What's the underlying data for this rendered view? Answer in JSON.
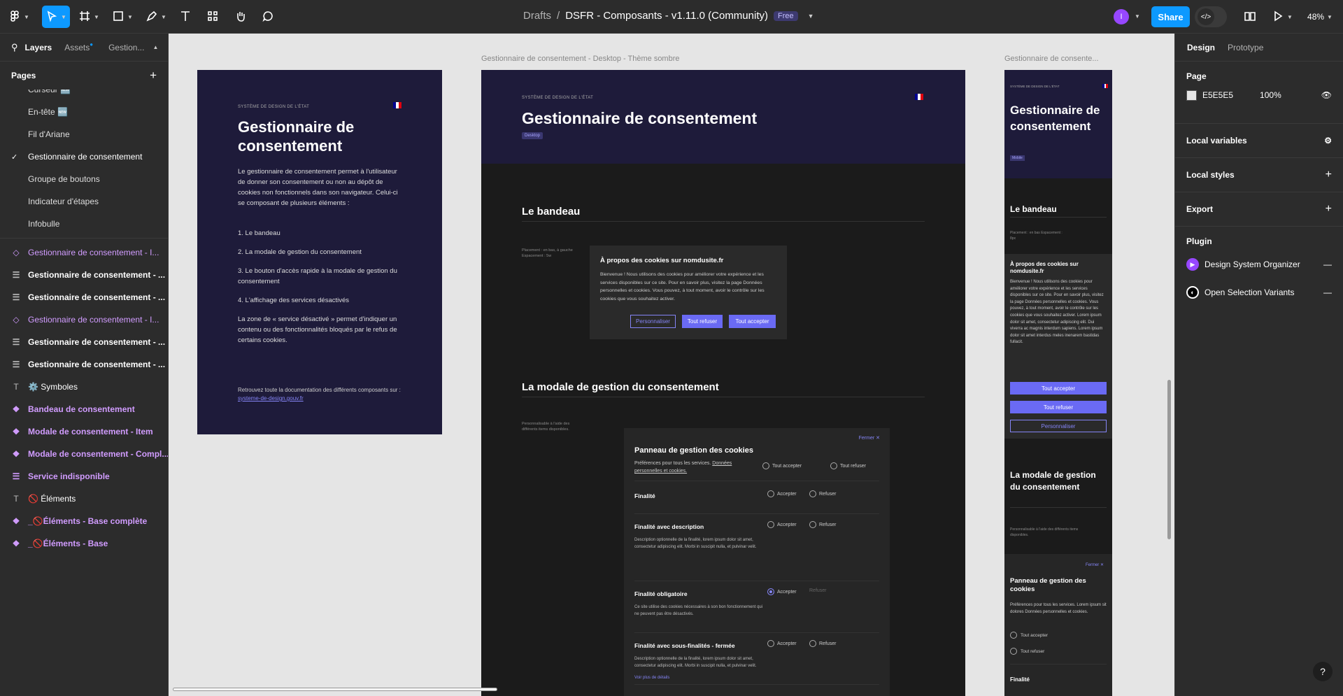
{
  "topbar": {
    "breadcrumb_parent": "Drafts",
    "breadcrumb_sep": "/",
    "file_title": "DSFR - Composants - v1.11.0 (Community)",
    "plan_badge": "Free",
    "avatar_initial": "I",
    "share_label": "Share",
    "zoom": "48%"
  },
  "left_panel": {
    "tabs": [
      "Layers",
      "Assets",
      "Gestion..."
    ],
    "pages_heading": "Pages",
    "pages": [
      "Curseur 🆕",
      "En-tête 🆕",
      "Fil d'Ariane",
      "Gestionnaire de consentement",
      "Groupe de boutons",
      "Indicateur d'étapes",
      "Infobulle"
    ],
    "layers": [
      {
        "label": "Gestionnaire de consentement - I...",
        "icon": "component-instance-icon",
        "style": "purple"
      },
      {
        "label": "Gestionnaire de consentement - ...",
        "icon": "frame-icon",
        "style": "bold"
      },
      {
        "label": "Gestionnaire de consentement - ...",
        "icon": "frame-icon",
        "style": "bold"
      },
      {
        "label": "Gestionnaire de consentement - I...",
        "icon": "component-instance-icon",
        "style": "purple"
      },
      {
        "label": "Gestionnaire de consentement - ...",
        "icon": "frame-icon",
        "style": "bold"
      },
      {
        "label": "Gestionnaire de consentement - ...",
        "icon": "frame-icon",
        "style": "bold"
      },
      {
        "label": "⚙️ Symboles",
        "icon": "text-icon",
        "style": "normal"
      },
      {
        "label": "Bandeau de consentement",
        "icon": "component-icon",
        "style": "purple bold"
      },
      {
        "label": "Modale de consentement - Item",
        "icon": "component-icon",
        "style": "purple bold"
      },
      {
        "label": "Modale de consentement - Compl...",
        "icon": "component-icon",
        "style": "purple bold"
      },
      {
        "label": "Service indisponible",
        "icon": "frame-icon",
        "style": "purple bold"
      },
      {
        "label": "🚫 Éléments",
        "icon": "text-icon",
        "style": "normal"
      },
      {
        "label": "_🚫Éléments - Base complète",
        "icon": "component-icon",
        "style": "purple bold"
      },
      {
        "label": "_🚫Éléments - Base",
        "icon": "component-icon",
        "style": "purple bold"
      }
    ]
  },
  "right_panel": {
    "tabs": [
      "Design",
      "Prototype"
    ],
    "page_heading": "Page",
    "page_color": "E5E5E5",
    "page_opacity": "100%",
    "sections": [
      "Local variables",
      "Local styles",
      "Export"
    ],
    "plugin_heading": "Plugin",
    "plugins": [
      "Design System Organizer",
      "Open Selection Variants"
    ],
    "help": "?"
  },
  "canvas": {
    "bg_color": "#e5e5e5",
    "frame_labels": [
      "Gestionnaire de consentement - Desktop - Thème sombre",
      "Gestionnaire de consente..."
    ],
    "intro": {
      "kicker": "SYSTÈME DE DESIGN DE L'ÉTAT",
      "title": "Gestionnaire de consentement",
      "p1": "Le gestionnaire de consentement permet à l'utilisateur de donner son consentement ou non au dépôt de cookies non fonctionnels dans son navigateur. Celui-ci se composant de plusieurs éléments :",
      "items": [
        "1. Le bandeau",
        "2. La modale de gestion du consentement",
        "3. Le bouton d'accès rapide à la modale de gestion du consentement",
        "4. L'affichage des services désactivés"
      ],
      "p2": "La zone de « service désactivé » permet d'indiquer un contenu ou des fonctionnalités bloqués par le refus de certains cookies.",
      "footer": "Retrouvez toute la documentation des différents composants sur :",
      "footer_link": "systeme-de-design.gouv.fr"
    },
    "desktop": {
      "kicker": "SYSTÈME DE DESIGN DE L'ÉTAT",
      "title": "Gestionnaire de consentement",
      "tag": "Desktop",
      "section1": "Le bandeau",
      "banner_note": "Placement : en bas, à gauche  Espacement : 5w",
      "banner_title": "À propos des cookies sur nomdusite.fr",
      "banner_text": "Bienvenue ! Nous utilisons des cookies pour améliorer votre expérience et les services disponibles sur ce site. Pour en savoir plus, visitez la page Données personnelles et cookies. Vous pouvez, à tout moment, avoir le contrôle sur les cookies que vous souhaitez activer.",
      "btn_customize": "Personnaliser",
      "btn_refuse": "Tout refuser",
      "btn_accept": "Tout accepter",
      "section2": "La modale de gestion du consentement",
      "modal_note": "Personnalisable à l'aide des différents items disponibles.",
      "close": "Fermer",
      "panel_title": "Panneau de gestion des cookies",
      "panel_pref": "Préférences pour tous les services.",
      "panel_link": "Données personnelles et cookies.",
      "opt_accept_all": "Tout accepter",
      "opt_refuse_all": "Tout refuser",
      "accept": "Accepter",
      "refuse": "Refuser",
      "rows": [
        {
          "title": "Finalité",
          "desc": ""
        },
        {
          "title": "Finalité avec description",
          "desc": "Description optionnelle de la finalité, lorem ipsum dolor sit amet, consectetur adipiscing elit. Morbi in suscipit nulla, et pulvinar velit."
        },
        {
          "title": "Finalité obligatoire",
          "desc": "Ce site utilise des cookies nécessaires à son bon fonctionnement qui ne peuvent pas être désactivés."
        },
        {
          "title": "Finalité avec sous-finalités - fermée",
          "desc": "Description optionnelle de la finalité, lorem ipsum dolor sit amet, consectetur adipiscing elit. Morbi in suscipit nulla, et pulvinar velit."
        }
      ],
      "more": "Voir plus de détails"
    },
    "mobile": {
      "kicker": "SYSTÈME DE DESIGN DE L'ÉTAT",
      "title": "Gestionnaire de consentement",
      "tag": "Mobile",
      "section1": "Le bandeau",
      "note": "Placement : en bas  Espacement : 8px",
      "banner_title": "À propos des cookies sur nomdusite.fr",
      "banner_text": "Bienvenue ! Nous utilisons des cookies pour améliorer votre expérience et les services disponibles sur ce site. Pour en savoir plus, visitez la page Données personnelles et cookies. Vous pouvez, à tout moment, avoir le contrôle sur les cookies que vous souhaitez activer. Lorem ipsum dolor sit amet, consectetur adipiscing elit. Dui viverra ac magnis interdum sapiens. Lorem ipsum dolor sit amet interdus meles inenarem bastidas fullacit.",
      "btn_accept": "Tout accepter",
      "btn_refuse": "Tout refuser",
      "btn_customize": "Personnaliser",
      "section2": "La modale de gestion du consentement",
      "note2": "Personnalisable à l'aide des différents items disponibles.",
      "close": "Fermer",
      "panel_title": "Panneau de gestion des cookies",
      "panel_text": "Préférences pour tous les services. Lorem ipsum sit dolores Données personnelles et cookies.",
      "opt_accept_all": "Tout accepter",
      "opt_refuse_all": "Tout refuser",
      "row": "Finalité"
    }
  }
}
